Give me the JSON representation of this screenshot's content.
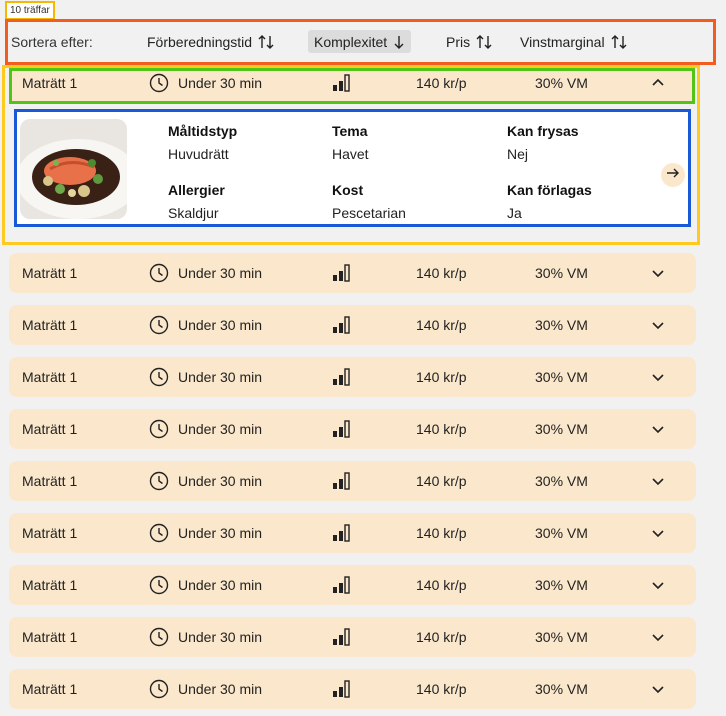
{
  "results": {
    "count_label": "10 träffar"
  },
  "sort": {
    "label": "Sortera efter:",
    "options": [
      {
        "label": "Förberedningstid",
        "direction": "both",
        "active": false
      },
      {
        "label": "Komplexitet",
        "direction": "down",
        "active": true
      },
      {
        "label": "Pris",
        "direction": "both",
        "active": false
      },
      {
        "label": "Vinstmarginal",
        "direction": "both",
        "active": false
      }
    ]
  },
  "dishes": [
    {
      "name": "Maträtt 1",
      "time": "Under 30 min",
      "complexity_bars": 3,
      "price": "140 kr/p",
      "margin": "30% VM",
      "expanded": true
    },
    {
      "name": "Maträtt 1",
      "time": "Under 30 min",
      "complexity_bars": 3,
      "price": "140 kr/p",
      "margin": "30% VM",
      "expanded": false
    },
    {
      "name": "Maträtt 1",
      "time": "Under 30 min",
      "complexity_bars": 3,
      "price": "140 kr/p",
      "margin": "30% VM",
      "expanded": false
    },
    {
      "name": "Maträtt 1",
      "time": "Under 30 min",
      "complexity_bars": 3,
      "price": "140 kr/p",
      "margin": "30% VM",
      "expanded": false
    },
    {
      "name": "Maträtt 1",
      "time": "Under 30 min",
      "complexity_bars": 3,
      "price": "140 kr/p",
      "margin": "30% VM",
      "expanded": false
    },
    {
      "name": "Maträtt 1",
      "time": "Under 30 min",
      "complexity_bars": 3,
      "price": "140 kr/p",
      "margin": "30% VM",
      "expanded": false
    },
    {
      "name": "Maträtt 1",
      "time": "Under 30 min",
      "complexity_bars": 3,
      "price": "140 kr/p",
      "margin": "30% VM",
      "expanded": false
    },
    {
      "name": "Maträtt 1",
      "time": "Under 30 min",
      "complexity_bars": 3,
      "price": "140 kr/p",
      "margin": "30% VM",
      "expanded": false
    },
    {
      "name": "Maträtt 1",
      "time": "Under 30 min",
      "complexity_bars": 3,
      "price": "140 kr/p",
      "margin": "30% VM",
      "expanded": false
    },
    {
      "name": "Maträtt 1",
      "time": "Under 30 min",
      "complexity_bars": 3,
      "price": "140 kr/p",
      "margin": "30% VM",
      "expanded": false
    }
  ],
  "details": {
    "fields": [
      {
        "key": "Måltidstyp",
        "value": "Huvudrätt"
      },
      {
        "key": "Tema",
        "value": "Havet"
      },
      {
        "key": "Kan frysas",
        "value": "Nej"
      },
      {
        "key": "Allergier",
        "value": "Skaldjur"
      },
      {
        "key": "Kost",
        "value": "Pescetarian"
      },
      {
        "key": "Kan förlagas",
        "value": "Ja"
      }
    ]
  },
  "icons": {
    "clock": "clock-icon",
    "complexity": "complexity-bars-icon",
    "expand": "chevron-down-icon",
    "collapse": "chevron-up-icon",
    "go": "arrow-right-icon",
    "sort_both": "sort-up-down-icon",
    "sort_down": "arrow-down-icon"
  },
  "colors": {
    "row_bg": "#fbe8cc",
    "active_sort_bg": "#dcdcdc",
    "page_bg": "#f1f1f1"
  }
}
